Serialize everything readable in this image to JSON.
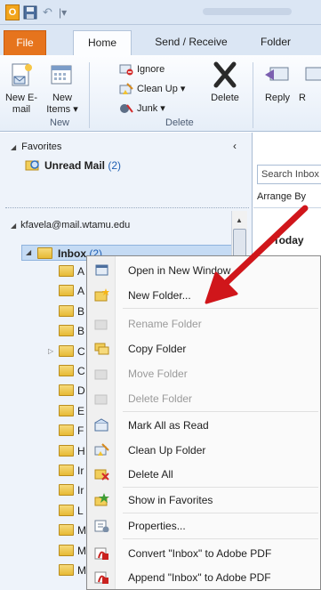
{
  "ribbon": {
    "tabs": [
      "File",
      "Home",
      "Send / Receive",
      "Folder"
    ],
    "new_email_label": "New E-mail",
    "new_items_label": "New Items",
    "ignore_label": "Ignore",
    "cleanup_label": "Clean Up",
    "junk_label": "Junk",
    "delete_label": "Delete",
    "reply_label": "Reply",
    "replyall_label": "R",
    "group_new": "New",
    "group_delete": "Delete"
  },
  "nav": {
    "favorites_label": "Favorites",
    "unread_label": "Unread Mail",
    "unread_count": "(2)",
    "account": "kfavela@mail.wtamu.edu",
    "inbox_label": "Inbox",
    "inbox_count": "(2)",
    "subfolder_letters": [
      "A",
      "A",
      "B",
      "B",
      "C",
      "C",
      "D",
      "E",
      "F",
      "H",
      "Ir",
      "Ir",
      "L",
      "M",
      "M",
      "M"
    ]
  },
  "list": {
    "search_placeholder": "Search Inbox",
    "arrange_label": "Arrange By",
    "today_label": "Today"
  },
  "context_menu": {
    "items": [
      {
        "label": "Open in New Window",
        "icon": "open-window-icon",
        "enabled": true
      },
      {
        "label": "New Folder...",
        "icon": "new-folder-icon",
        "enabled": true
      },
      {
        "label": "Rename Folder",
        "icon": "rename-folder-icon",
        "enabled": false
      },
      {
        "label": "Copy Folder",
        "icon": "copy-folder-icon",
        "enabled": true
      },
      {
        "label": "Move Folder",
        "icon": "move-folder-icon",
        "enabled": false
      },
      {
        "label": "Delete Folder",
        "icon": "delete-folder-icon",
        "enabled": false
      },
      {
        "label": "Mark All as Read",
        "icon": "mark-read-icon",
        "enabled": true
      },
      {
        "label": "Clean Up Folder",
        "icon": "cleanup-folder-icon",
        "enabled": true
      },
      {
        "label": "Delete All",
        "icon": "delete-all-icon",
        "enabled": true
      },
      {
        "label": "Show in Favorites",
        "icon": "favorites-icon",
        "enabled": true
      },
      {
        "label": "Properties...",
        "icon": "properties-icon",
        "enabled": true
      },
      {
        "label": "Convert \"Inbox\" to Adobe PDF",
        "icon": "pdf-convert-icon",
        "enabled": true
      },
      {
        "label": "Append \"Inbox\" to Adobe PDF",
        "icon": "pdf-append-icon",
        "enabled": true
      }
    ]
  },
  "colors": {
    "file_tab": "#e6741d",
    "accent_blue": "#1f5fb3",
    "arrow_red": "#d0161b",
    "folder_yellow": "#e6b935"
  }
}
